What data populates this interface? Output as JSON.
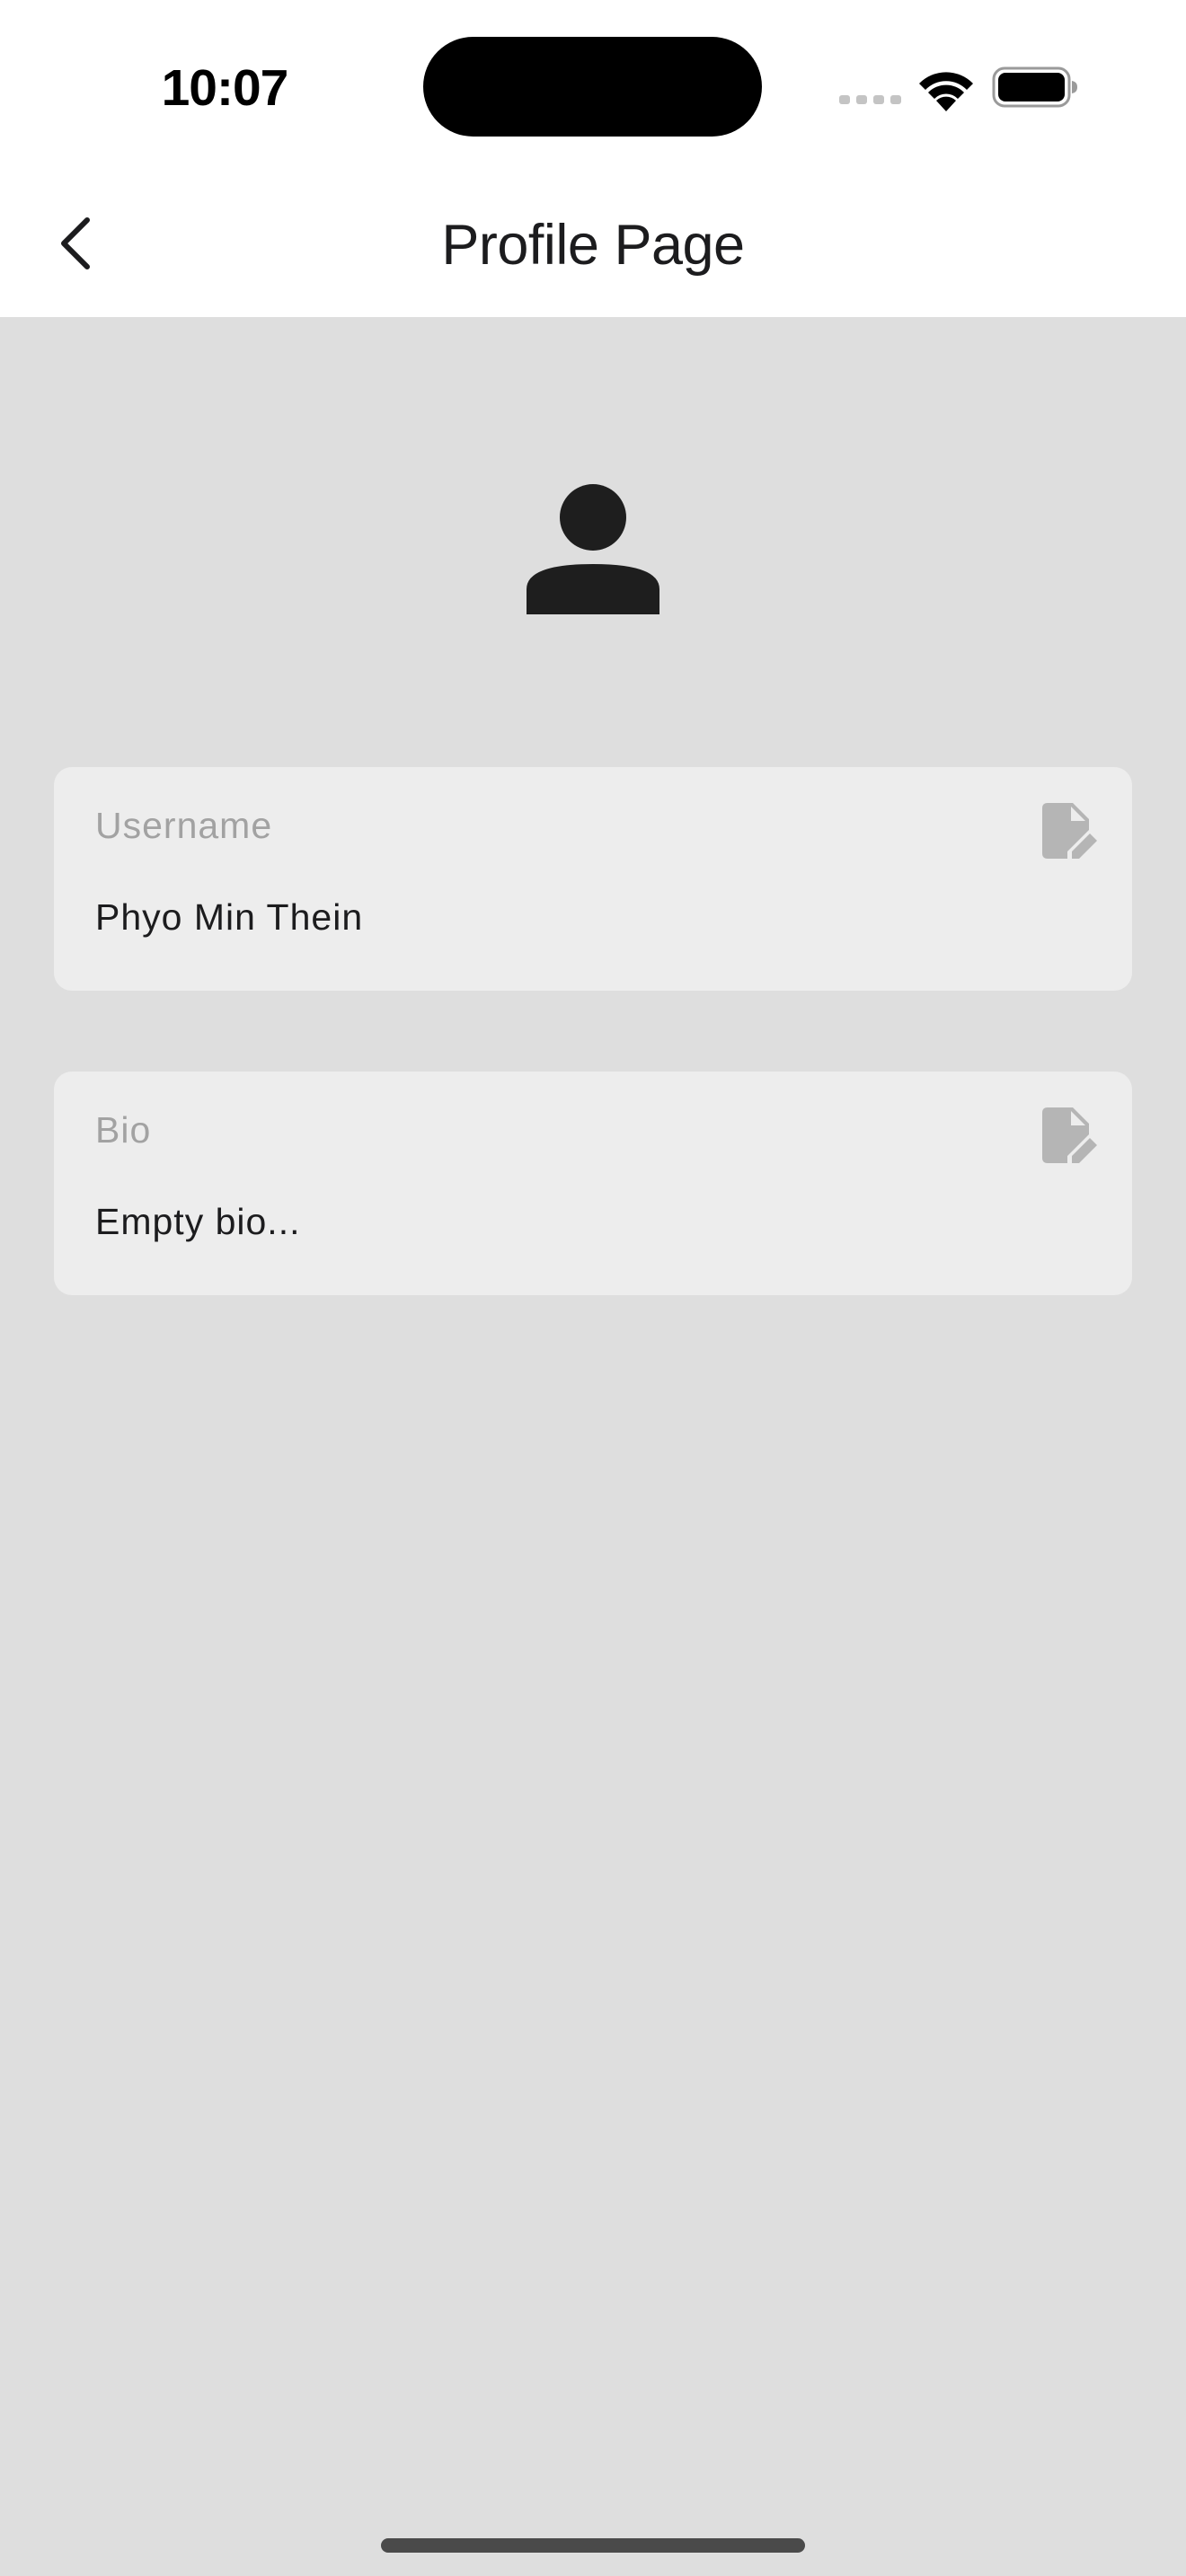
{
  "status_bar": {
    "time": "10:07",
    "icons": [
      "cellular-signal-icon",
      "wifi-icon",
      "battery-icon"
    ]
  },
  "app_bar": {
    "title": "Profile Page",
    "back_icon": "chevron-left-icon"
  },
  "profile": {
    "avatar_icon": "person-icon",
    "fields": [
      {
        "label": "Username",
        "value": "Phyo Min Thein",
        "edit_icon": "edit-document-icon"
      },
      {
        "label": "Bio",
        "value": "Empty bio...",
        "edit_icon": "edit-document-icon"
      }
    ]
  },
  "colors": {
    "background": "#dedede",
    "card": "#ededed",
    "topbar": "#ffffff",
    "label_text": "#a2a2a2",
    "value_text": "#1c1c1e",
    "icon_muted": "#b5b5b5",
    "avatar": "#1e1e1e"
  }
}
